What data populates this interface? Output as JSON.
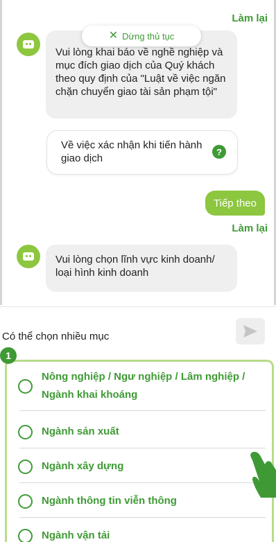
{
  "chat": {
    "redo_label": "Làm lại",
    "stop_label": "Dừng thủ tục",
    "bot_message_1": "Vui lòng khai báo về nghề nghiệp và mục đích giao dịch của Quý khách theo quy định của \"Luật về việc ngăn chặn chuyển giao tài sản phạm tội\"",
    "confirm_card": "Về việc xác nhận khi tiến hành giao dịch",
    "help_glyph": "?",
    "user_reply": "Tiếp theo",
    "bot_message_2": "Vui lòng chọn lĩnh vực kinh doanh/ loại hình kinh doanh"
  },
  "panel": {
    "hint": "Có thể chọn nhiều mục",
    "options": [
      "Nông nghiệp / Ngư nghiệp / Lâm nghiệp / Ngành khai khoáng",
      "Ngành sản xuất",
      "Ngành xây dựng",
      "Ngành thông tin viễn thông",
      "Ngành vận tải"
    ]
  },
  "step_badge": "1",
  "colors": {
    "accent": "#3f9a36",
    "avatar": "#8dc63f",
    "highlight_border": "#b7dc8a"
  },
  "icons": [
    "bot-avatar-icon",
    "close-icon",
    "help-icon",
    "send-icon",
    "radio-icon",
    "pointing-hand-icon"
  ]
}
